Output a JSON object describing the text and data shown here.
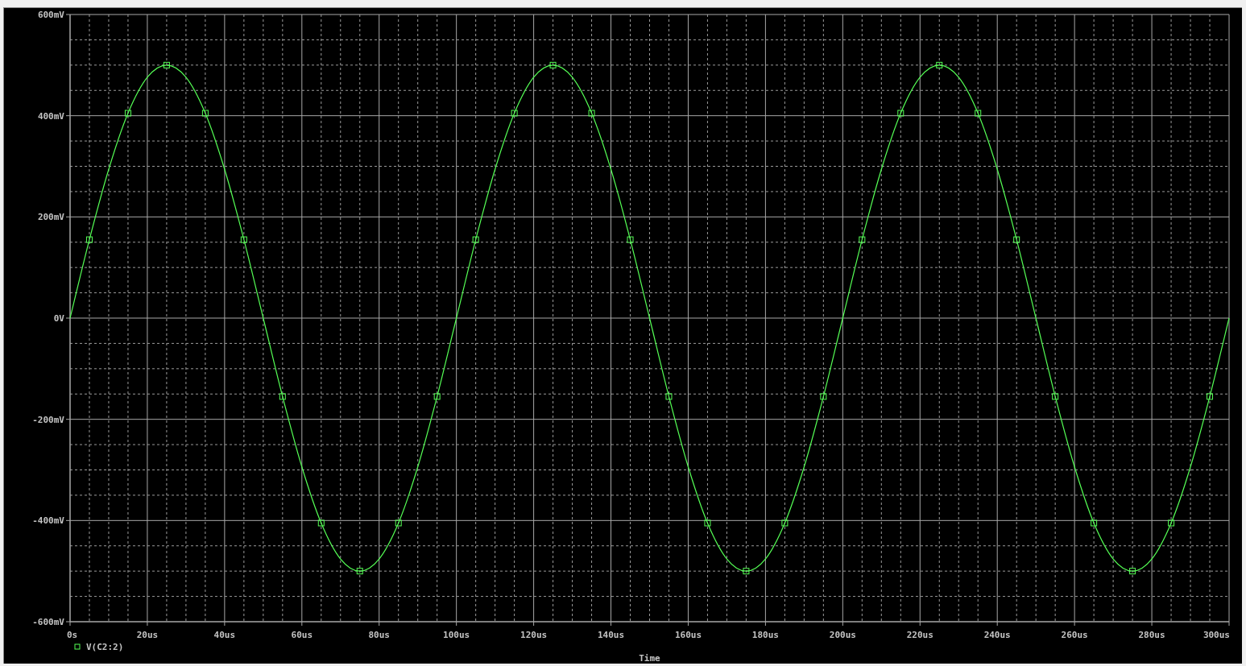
{
  "chart_data": {
    "type": "line",
    "xlabel": "Time",
    "grid": true,
    "x": [
      0,
      5,
      10,
      15,
      20,
      25,
      30,
      35,
      40,
      45,
      50,
      55,
      60,
      65,
      70,
      75,
      80,
      85,
      90,
      95,
      100,
      105,
      110,
      115,
      120,
      125,
      130,
      135,
      140,
      145,
      150,
      155,
      160,
      165,
      170,
      175,
      180,
      185,
      190,
      195,
      200,
      205,
      210,
      215,
      220,
      225,
      230,
      235,
      240,
      245,
      250,
      255,
      260,
      265,
      270,
      275,
      280,
      285,
      290,
      295,
      300
    ],
    "series": [
      {
        "name": "V(C2:2)",
        "color": "#55ff55",
        "values": [
          0,
          155,
          294,
          405,
          476,
          500,
          476,
          405,
          294,
          155,
          0,
          -155,
          -294,
          -405,
          -476,
          -500,
          -476,
          -405,
          -294,
          -155,
          0,
          155,
          294,
          405,
          476,
          500,
          476,
          405,
          294,
          155,
          0,
          -155,
          -294,
          -405,
          -476,
          -500,
          -476,
          -405,
          -294,
          -155,
          0,
          155,
          294,
          405,
          476,
          500,
          476,
          405,
          294,
          155,
          0,
          -155,
          -294,
          -405,
          -476,
          -500,
          -476,
          -405,
          -294,
          -155,
          0
        ]
      }
    ],
    "xlim": [
      0,
      300
    ],
    "ylim": [
      -600,
      600
    ],
    "xticks": [
      {
        "value": 0,
        "label": "0s"
      },
      {
        "value": 20,
        "label": "20us"
      },
      {
        "value": 40,
        "label": "40us"
      },
      {
        "value": 60,
        "label": "60us"
      },
      {
        "value": 80,
        "label": "80us"
      },
      {
        "value": 100,
        "label": "100us"
      },
      {
        "value": 120,
        "label": "120us"
      },
      {
        "value": 140,
        "label": "140us"
      },
      {
        "value": 160,
        "label": "160us"
      },
      {
        "value": 180,
        "label": "180us"
      },
      {
        "value": 200,
        "label": "200us"
      },
      {
        "value": 220,
        "label": "220us"
      },
      {
        "value": 240,
        "label": "240us"
      },
      {
        "value": 260,
        "label": "260us"
      },
      {
        "value": 280,
        "label": "280us"
      },
      {
        "value": 300,
        "label": "300us"
      }
    ],
    "yticks": [
      {
        "value": 600,
        "label": "600mV"
      },
      {
        "value": 400,
        "label": "400mV"
      },
      {
        "value": 200,
        "label": "200mV"
      },
      {
        "value": 0,
        "label": "0V"
      },
      {
        "value": -200,
        "label": "-200mV"
      },
      {
        "value": -400,
        "label": "-400mV"
      },
      {
        "value": -600,
        "label": "-600mV"
      }
    ]
  }
}
